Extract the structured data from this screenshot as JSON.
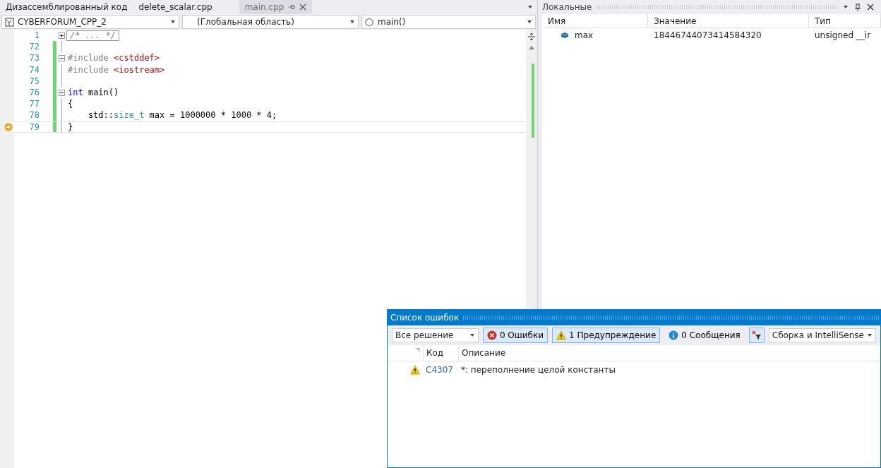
{
  "tabs": [
    {
      "label": "Дизассемблированный код",
      "selected": false
    },
    {
      "label": "delete_scalar.cpp",
      "selected": false
    },
    {
      "label": "main.cpp",
      "selected": true
    }
  ],
  "nav": {
    "project": "CYBERFORUM_CPP_2",
    "scope": "(Глобальная область)",
    "member": "main()"
  },
  "code": [
    {
      "number": "1",
      "kind": "collapsed",
      "changed": false,
      "current": false,
      "foldable": true,
      "folded": true,
      "tokens": [
        {
          "kind": "comment",
          "text": "/* ... */"
        }
      ]
    },
    {
      "number": "72",
      "kind": "code",
      "changed": true,
      "current": false
    },
    {
      "number": "73",
      "kind": "code",
      "changed": true,
      "current": false,
      "foldable": true,
      "folded": false,
      "tokens": [
        {
          "kind": "pp",
          "text": "#include "
        },
        {
          "kind": "str",
          "text": "<cstddef>"
        }
      ]
    },
    {
      "number": "74",
      "kind": "code",
      "changed": true,
      "current": false,
      "tokens": [
        {
          "kind": "pp",
          "text": "#include "
        },
        {
          "kind": "str",
          "text": "<iostream>"
        }
      ]
    },
    {
      "number": "75",
      "kind": "code",
      "changed": true,
      "current": false
    },
    {
      "number": "76",
      "kind": "code",
      "changed": true,
      "current": false,
      "foldable": true,
      "folded": false,
      "tokens": [
        {
          "kind": "kw",
          "text": "int"
        },
        {
          "kind": "plain",
          "text": " main()"
        }
      ]
    },
    {
      "number": "77",
      "kind": "code",
      "changed": true,
      "current": false,
      "tokens": [
        {
          "kind": "plain",
          "text": "{"
        }
      ]
    },
    {
      "number": "78",
      "kind": "code",
      "changed": true,
      "current": false,
      "tokens": [
        {
          "kind": "plain",
          "text": "    std::"
        },
        {
          "kind": "type",
          "text": "size_t"
        },
        {
          "kind": "plain",
          "text": " max = 1000000 * 1000 * 4;"
        }
      ]
    },
    {
      "number": "79",
      "kind": "code",
      "changed": true,
      "current": true,
      "tokens": [
        {
          "kind": "plain",
          "text": "}"
        }
      ]
    }
  ],
  "locals": {
    "title": "Локальные",
    "columns": [
      "Имя",
      "Значение",
      "Тип"
    ],
    "rows": [
      {
        "name": "max",
        "value": "18446744073414584320",
        "type": "unsigned __ir"
      }
    ]
  },
  "error_list": {
    "title": "Список ошибок",
    "scope": "Все решение",
    "filters": [
      {
        "kind": "error",
        "label": "0 Ошибки",
        "selected": true
      },
      {
        "kind": "warning",
        "label": "1 Предупреждение",
        "selected": true
      },
      {
        "kind": "info",
        "label": "0 Сообщения",
        "selected": false
      }
    ],
    "source": "Сборка и IntelliSense",
    "columns": [
      "Код",
      "Описание"
    ],
    "rows": [
      {
        "kind": "warning",
        "code": "C4307",
        "description": "*: переполнение целой константы"
      }
    ]
  }
}
